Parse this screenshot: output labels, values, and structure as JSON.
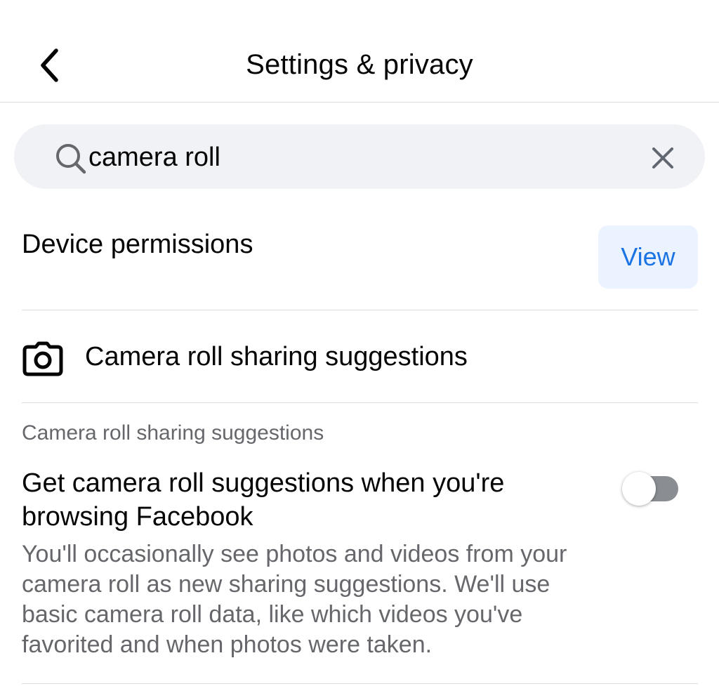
{
  "header": {
    "title": "Settings & privacy",
    "back_icon": "chevron-left-icon"
  },
  "search": {
    "value": "camera roll",
    "search_icon": "search-icon",
    "clear_icon": "close-icon"
  },
  "device_permissions": {
    "title": "Device permissions",
    "button_label": "View"
  },
  "camera_item": {
    "icon": "camera-icon",
    "label": "Camera roll sharing suggestions"
  },
  "setting": {
    "section_label": "Camera roll sharing suggestions",
    "title": "Get camera roll suggestions when you're browsing Facebook",
    "description": "You'll occasionally see photos and videos from your camera roll as new sharing suggestions. We'll use basic camera roll data, like which videos you've favorited and when photos were taken.",
    "toggle_on": false
  },
  "colors": {
    "accent": "#1b74e4",
    "button_bg": "#eaf3ff",
    "search_bg": "#f0f2f5",
    "secondary_text": "#65676b",
    "toggle_off_track": "#8a8d91"
  }
}
